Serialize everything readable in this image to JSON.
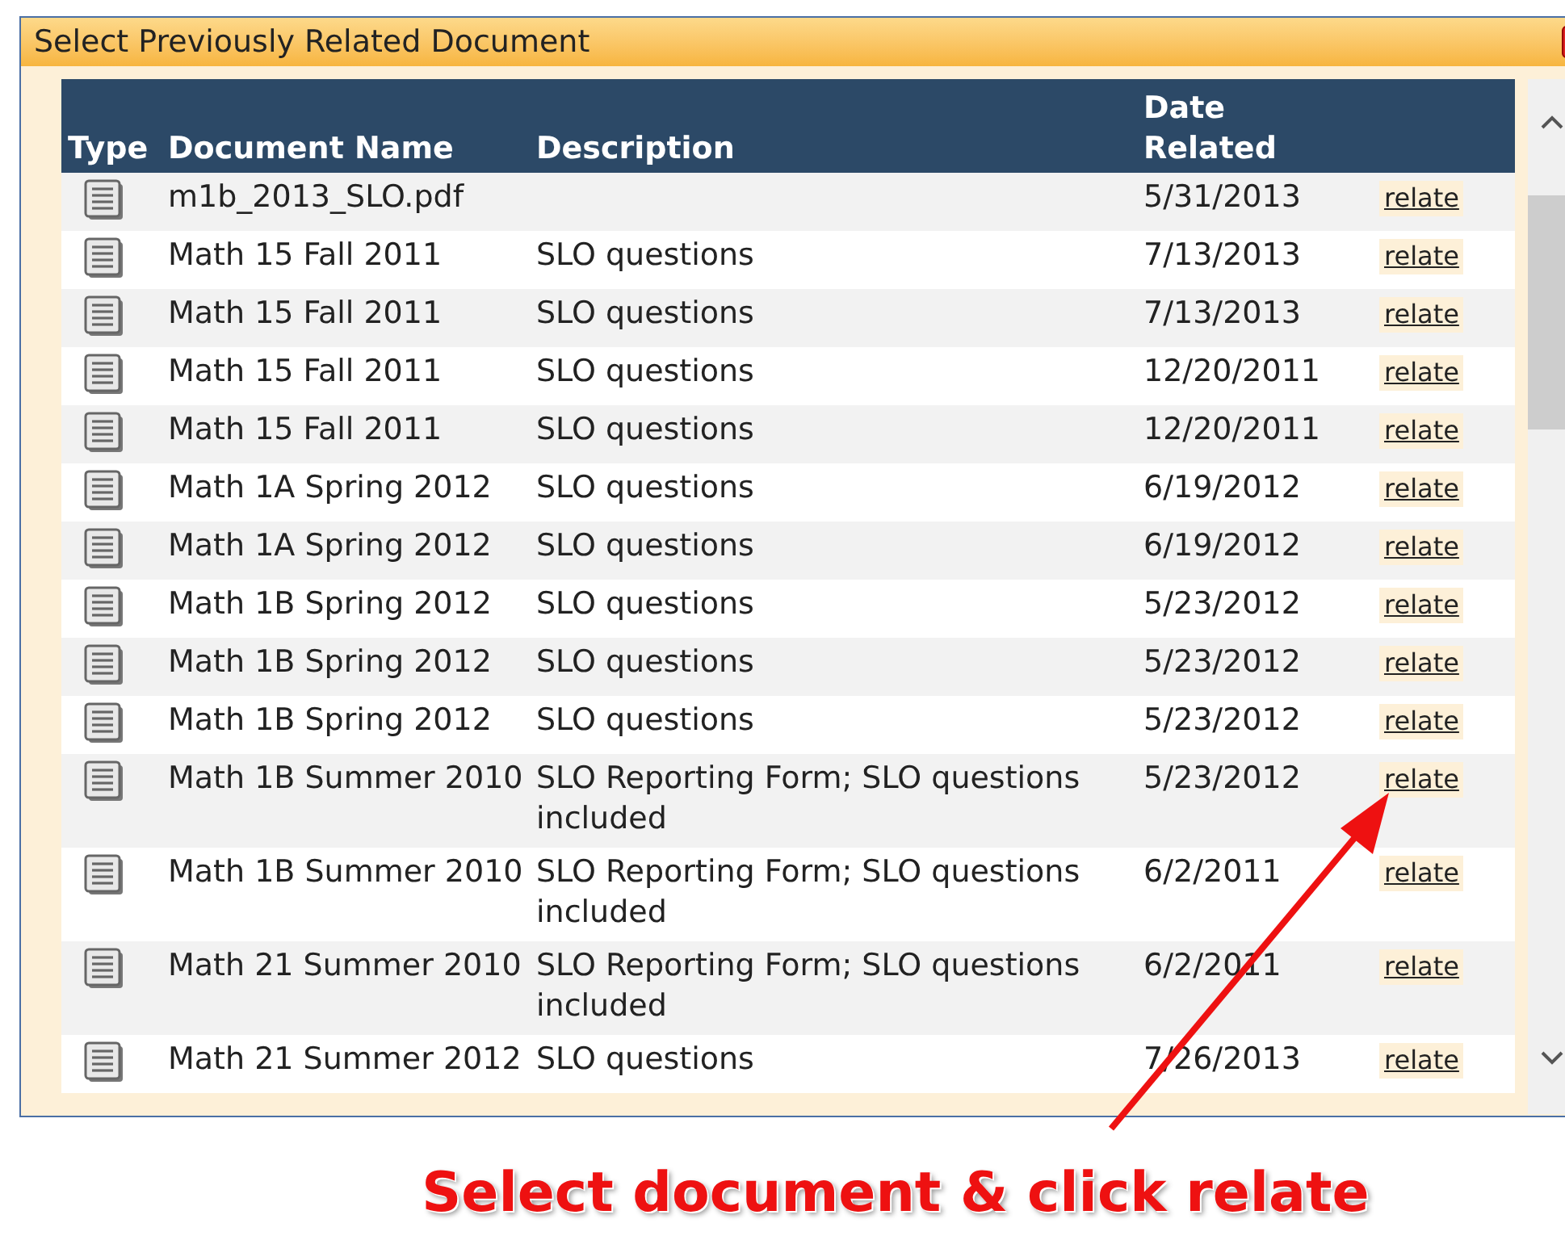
{
  "dialog": {
    "title": "Select Previously Related Document"
  },
  "table": {
    "columns": [
      "Type",
      "Document Name",
      "Description",
      "Date Related"
    ],
    "rows": [
      {
        "name": "m1b_2013_SLO.pdf",
        "description": "",
        "date": "5/31/2013",
        "action": "relate"
      },
      {
        "name": "Math 15 Fall 2011",
        "description": "SLO questions",
        "date": "7/13/2013",
        "action": "relate"
      },
      {
        "name": "Math 15 Fall 2011",
        "description": "SLO questions",
        "date": "7/13/2013",
        "action": "relate"
      },
      {
        "name": "Math 15 Fall 2011",
        "description": "SLO questions",
        "date": "12/20/2011",
        "action": "relate"
      },
      {
        "name": "Math 15 Fall 2011",
        "description": "SLO questions",
        "date": "12/20/2011",
        "action": "relate"
      },
      {
        "name": "Math 1A Spring 2012",
        "description": "SLO questions",
        "date": "6/19/2012",
        "action": "relate"
      },
      {
        "name": "Math 1A Spring 2012",
        "description": "SLO questions",
        "date": "6/19/2012",
        "action": "relate"
      },
      {
        "name": "Math 1B Spring 2012",
        "description": "SLO questions",
        "date": "5/23/2012",
        "action": "relate"
      },
      {
        "name": "Math 1B Spring 2012",
        "description": "SLO questions",
        "date": "5/23/2012",
        "action": "relate"
      },
      {
        "name": "Math 1B Spring 2012",
        "description": "SLO questions",
        "date": "5/23/2012",
        "action": "relate"
      },
      {
        "name": "Math 1B Summer 2010",
        "description": "SLO Reporting Form; SLO questions included",
        "date": "5/23/2012",
        "action": "relate"
      },
      {
        "name": "Math 1B Summer 2010",
        "description": "SLO Reporting Form; SLO questions included",
        "date": "6/2/2011",
        "action": "relate"
      },
      {
        "name": "Math 21 Summer 2010",
        "description": "SLO Reporting Form; SLO questions included",
        "date": "6/2/2011",
        "action": "relate"
      },
      {
        "name": "Math 21 Summer 2012",
        "description": "SLO questions",
        "date": "7/26/2013",
        "action": "relate"
      }
    ]
  },
  "annotation": {
    "text": "Select document & click relate"
  }
}
